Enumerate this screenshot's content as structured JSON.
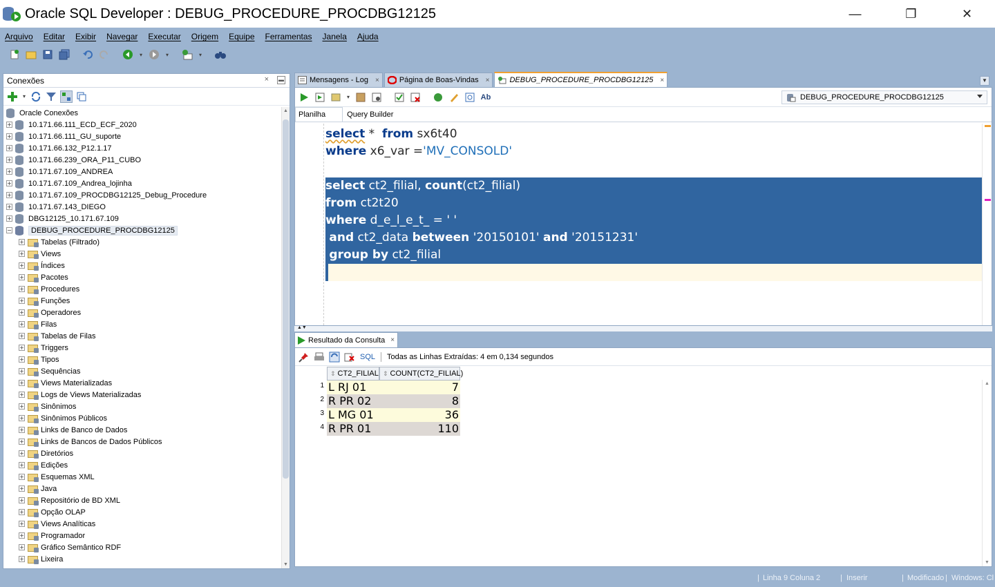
{
  "window": {
    "title": "Oracle SQL Developer : DEBUG_PROCEDURE_PROCDBG12125",
    "minimize": "—",
    "maximize": "❐",
    "close": "✕"
  },
  "menu": [
    "Arquivo",
    "Editar",
    "Exibir",
    "Navegar",
    "Executar",
    "Origem",
    "Equipe",
    "Ferramentas",
    "Janela",
    "Ajuda"
  ],
  "connections_panel": {
    "title": "Conexões",
    "close": "×",
    "root": "Oracle Conexões",
    "connections": [
      "10.171.66.111_ECD_ECF_2020",
      "10.171.66.111_GU_suporte",
      "10.171.66.132_P12.1.17",
      "10.171.66.239_ORA_P11_CUBO",
      "10.171.67.109_ANDREA",
      "10.171.67.109_Andrea_lojinha",
      "10.171.67.109_PROCDBG12125_Debug_Procedure",
      "10.171.67.143_DIEGO",
      "DBG12125_10.171.67.109"
    ],
    "open_connection": "DEBUG_PROCEDURE_PROCDBG12125",
    "children": [
      "Tabelas (Filtrado)",
      "Views",
      "Índices",
      "Pacotes",
      "Procedures",
      "Funções",
      "Operadores",
      "Filas",
      "Tabelas de Filas",
      "Triggers",
      "Tipos",
      "Sequências",
      "Views Materializadas",
      "Logs de Views Materializadas",
      "Sinônimos",
      "Sinônimos Públicos",
      "Links de Banco de Dados",
      "Links de Bancos de Dados Públicos",
      "Diretórios",
      "Edições",
      "Esquemas XML",
      "Java",
      "Repositório de BD XML",
      "Opção OLAP",
      "Views Analíticas",
      "Programador",
      "Gráfico Semântico RDF",
      "Lixeira"
    ]
  },
  "editor": {
    "tabs": [
      {
        "label": "Mensagens - Log",
        "close": "×"
      },
      {
        "label": "Página de Boas-Vindas",
        "close": "×"
      },
      {
        "label": "DEBUG_PROCEDURE_PROCDBG12125",
        "close": "×"
      }
    ],
    "connection_select": "DEBUG_PROCEDURE_PROCDBG12125",
    "subtabs": [
      "Planilha",
      "Query Builder"
    ],
    "code": {
      "l1_kw1": "select",
      "l1_rest1": " *  ",
      "l1_kw2": "from",
      "l1_rest2": " sx6t40",
      "l2_kw": "where",
      "l2_rest": " x6_var =",
      "l2_str": "'MV_CONSOLD'",
      "l4_kw1": "select",
      "l4_rest1": " ct2_filial, ",
      "l4_kw2": "count",
      "l4_rest2": "(ct2_filial)",
      "l5_kw": "from",
      "l5_rest": " ct2t20",
      "l6_kw": "where",
      "l6_rest": " d_e_l_e_t_ = ",
      "l6_str": "' '",
      "l7_pre": " ",
      "l7_kw1": "and",
      "l7_rest1": " ct2_data ",
      "l7_kw2": "between",
      "l7_sp": " ",
      "l7_str1": "'20150101'",
      "l7_sp2": " ",
      "l7_kw3": "and",
      "l7_sp3": " ",
      "l7_str2": "'20151231'",
      "l8_pre": " ",
      "l8_kw": "group by",
      "l8_rest": " ct2_filial"
    }
  },
  "result": {
    "tab_label": "Resultado da Consulta",
    "tab_close": "×",
    "sql_link": "SQL",
    "status": "Todas as Linhas Extraídas: 4 em 0,134 segundos",
    "columns": [
      "CT2_FILIAL",
      "COUNT(CT2_FILIAL)"
    ],
    "rows": [
      {
        "n": "1",
        "filial": "L RJ 01",
        "count": "7"
      },
      {
        "n": "2",
        "filial": "R PR 02",
        "count": "8"
      },
      {
        "n": "3",
        "filial": "L MG 01",
        "count": "36"
      },
      {
        "n": "4",
        "filial": "R PR 01",
        "count": "110"
      }
    ]
  },
  "statusbar": {
    "position": "Linha 9 Coluna 2",
    "mode": "Inserir",
    "state": "Modificado",
    "os": "Windows: Cl"
  }
}
